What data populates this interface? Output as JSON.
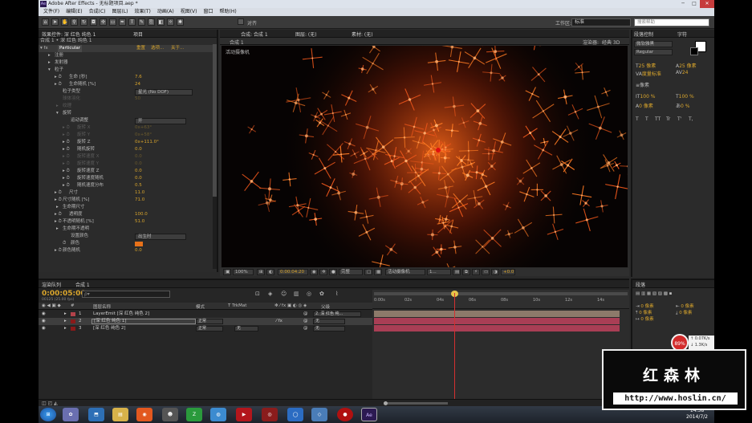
{
  "app": {
    "title": "Adobe After Effects - 无标题项目.aep *",
    "icon": "Ae"
  },
  "menu": [
    "文件(F)",
    "编辑(E)",
    "合成(C)",
    "图层(L)",
    "效果(T)",
    "动画(A)",
    "视图(V)",
    "窗口",
    "帮助(H)"
  ],
  "toolbar": {
    "align_label": "对齐",
    "workspace_label": "工作区:",
    "workspace_value": "标准",
    "search_placeholder": "搜索帮助"
  },
  "effect_controls": {
    "tab_label": "效果控件: 深 红色 纯色 1",
    "tab2_label": "项目",
    "breadcrumb": "合成 1 • 深 红色 纯色 1",
    "effect_name": "Particular",
    "reset": "重置",
    "options": "选项...",
    "about": "关于...",
    "rows": [
      {
        "label": "注册",
        "value": ""
      },
      {
        "label": "发射器",
        "value": ""
      },
      {
        "label": "粒子",
        "value": ""
      },
      {
        "label": "生命 [秒]",
        "value": "7.6"
      },
      {
        "label": "生命随机 [%]",
        "value": "24"
      },
      {
        "label": "粒子类型",
        "value": "星光 (No DOF)"
      },
      {
        "label": "球体羽化",
        "value": "50"
      },
      {
        "label": "纹理",
        "value": ""
      },
      {
        "label": "旋转",
        "value": ""
      },
      {
        "label": "运动调整",
        "value": "开"
      },
      {
        "label": "旋转 X",
        "value": "0x+63°"
      },
      {
        "label": "旋转 Y",
        "value": "0x+58°"
      },
      {
        "label": "旋转 Z",
        "value": "0x+111.0°"
      },
      {
        "label": "随机旋转",
        "value": "0.0"
      },
      {
        "label": "旋转速度 X",
        "value": "0.0"
      },
      {
        "label": "旋转速度 Y",
        "value": "0.0"
      },
      {
        "label": "旋转速度 Z",
        "value": "0.0"
      },
      {
        "label": "旋转速度随机",
        "value": "0.0"
      },
      {
        "label": "随机速度分布",
        "value": "0.5"
      },
      {
        "label": "尺寸",
        "value": "11.0"
      },
      {
        "label": "尺寸随机 [%]",
        "value": "71.0"
      },
      {
        "label": "生命期尺寸",
        "value": ""
      },
      {
        "label": "透明度",
        "value": "100.0"
      },
      {
        "label": "不透明随机 [%]",
        "value": "51.0"
      },
      {
        "label": "生命期不透明",
        "value": ""
      },
      {
        "label": "设置颜色",
        "value": "出生时"
      },
      {
        "label": "颜色",
        "value": ""
      },
      {
        "label": "颜色随机",
        "value": "0.0"
      }
    ],
    "color_swatch": "#e8721a"
  },
  "composition": {
    "tab_label": "合成: 合成 1",
    "layer_tab": "图层: (无)",
    "footage_tab": "素材: (无)",
    "sub_tab": "合成 1",
    "renderer": "渲染器:",
    "renderer_value": "经典 3D",
    "view_label": "活动摄像机",
    "zoom": "100%",
    "timecode": "0:00:04:20",
    "quality": "完整",
    "camera": "活动摄像机",
    "views": "1...",
    "exposure": "+0.0"
  },
  "info_panel": {
    "tab1": "信息",
    "tab2": "音频",
    "preview_tab": "预览",
    "char_tab1": "段落控制",
    "char_tab2": "字符",
    "font": "微软雅黑",
    "font_style": "Regular",
    "size": "25 像素",
    "leading": "25 像素",
    "kerning": "度量标准",
    "tracking": "24",
    "stroke": "像素",
    "scale_v": "100 %",
    "scale_h": "100 %",
    "baseline": "0 像素",
    "tsume": "0 %",
    "styles": [
      "T",
      "T",
      "TT",
      "Tr",
      "T'",
      "T,"
    ]
  },
  "timeline": {
    "tab1": "渲染队列",
    "tab2": "合成 1",
    "timecode": "0:00:05:00",
    "timecode_sub": "00125 (25.00 fps)",
    "search_placeholder": "ρ▾",
    "headers": {
      "num": "#",
      "name": "图层名称",
      "mode": "模式",
      "trkmat": "T TrkMat",
      "parent": "父级"
    },
    "layers": [
      {
        "num": "1",
        "name": "LayerEmit [深 红色 纯色 2]",
        "mode": "",
        "trkmat": "",
        "parent": "2. 深 红色 纯...",
        "color": "#b2424a"
      },
      {
        "num": "2",
        "name": "[深 红色 纯色 1]",
        "mode": "正常",
        "trkmat": "",
        "parent": "无",
        "color": "#8a1a1a"
      },
      {
        "num": "3",
        "name": "[深 红色 纯色 2]",
        "mode": "正常",
        "trkmat": "无",
        "parent": "无",
        "color": "#8a1a1a"
      }
    ],
    "ruler": [
      "0:00s",
      "02s",
      "04s",
      "06s",
      "08s",
      "10s",
      "12s",
      "14s"
    ],
    "track_colors": [
      "#8d7a6a",
      "#a93e55",
      "#a93e55"
    ]
  },
  "right_bottom": {
    "tab": "段落",
    "items": [
      "0 像素",
      "0 像素",
      "0 像素",
      "0 像素",
      "0 像素"
    ]
  },
  "network": {
    "percent": "89%",
    "up": "0.07K/s",
    "down": "1.3K/s"
  },
  "taskbar": {
    "time": "14:38",
    "date": "2014/7/2"
  },
  "watermark": {
    "brand": "红森林",
    "url": "http://www.hoslin.cn/"
  }
}
